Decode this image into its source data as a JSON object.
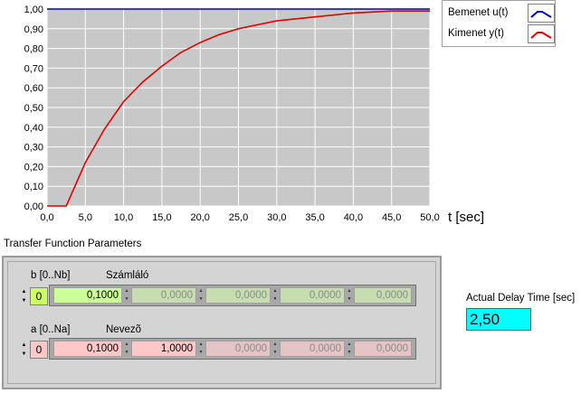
{
  "chart_data": {
    "type": "line",
    "title": "",
    "xlabel": "t [sec]",
    "ylabel": "",
    "xlim": [
      0,
      50
    ],
    "ylim": [
      0,
      1
    ],
    "x_ticks": [
      "0,0",
      "5,0",
      "10,0",
      "15,0",
      "20,0",
      "25,0",
      "30,0",
      "35,0",
      "40,0",
      "45,0",
      "50,0"
    ],
    "y_ticks": [
      "0,00",
      "0,10",
      "0,20",
      "0,30",
      "0,40",
      "0,50",
      "0,60",
      "0,70",
      "0,80",
      "0,90",
      "1,00"
    ],
    "grid": true,
    "legend": "top-right",
    "series": [
      {
        "name": "Bemenet u(t)",
        "color": "#0000cc",
        "x": [
          0,
          50
        ],
        "y": [
          1.0,
          1.0
        ]
      },
      {
        "name": "Kimenet y(t)",
        "color": "#dd0000",
        "x": [
          0,
          2.5,
          5,
          7.5,
          10,
          12.5,
          15,
          17.5,
          20,
          22.5,
          25,
          27.5,
          30,
          35,
          40,
          45,
          50
        ],
        "y": [
          0,
          0,
          0.22,
          0.39,
          0.53,
          0.63,
          0.71,
          0.78,
          0.83,
          0.87,
          0.9,
          0.92,
          0.94,
          0.96,
          0.98,
          0.99,
          0.99
        ]
      }
    ]
  },
  "colors": {
    "plot_bg": "#c8c8c8",
    "grid": "#ffffff",
    "numerator_active": "#ccff99",
    "numerator_inactive": "#c6ddb0",
    "denominator_active": "#ffc8c8",
    "denominator_inactive": "#e4c4c4",
    "index_numerator": "#ccff66",
    "index_denominator": "#ffc8c8",
    "delay_bg": "#00ffff"
  },
  "section_title": "Transfer Function Parameters",
  "numerator": {
    "index_label": "b [0..Nb]",
    "name": "Számláló",
    "index": "0",
    "values": [
      "0,1000",
      "0,0000",
      "0,0000",
      "0,0000",
      "0,0000"
    ]
  },
  "denominator": {
    "index_label": "a [0..Na]",
    "name": "Nevezõ",
    "index": "0",
    "values": [
      "0,1000",
      "1,0000",
      "0,0000",
      "0,0000",
      "0,0000"
    ]
  },
  "delay": {
    "label": "Actual Delay Time [sec]",
    "value": "2,50"
  },
  "icons": {
    "spin_up": "▲",
    "spin_down": "▼"
  }
}
